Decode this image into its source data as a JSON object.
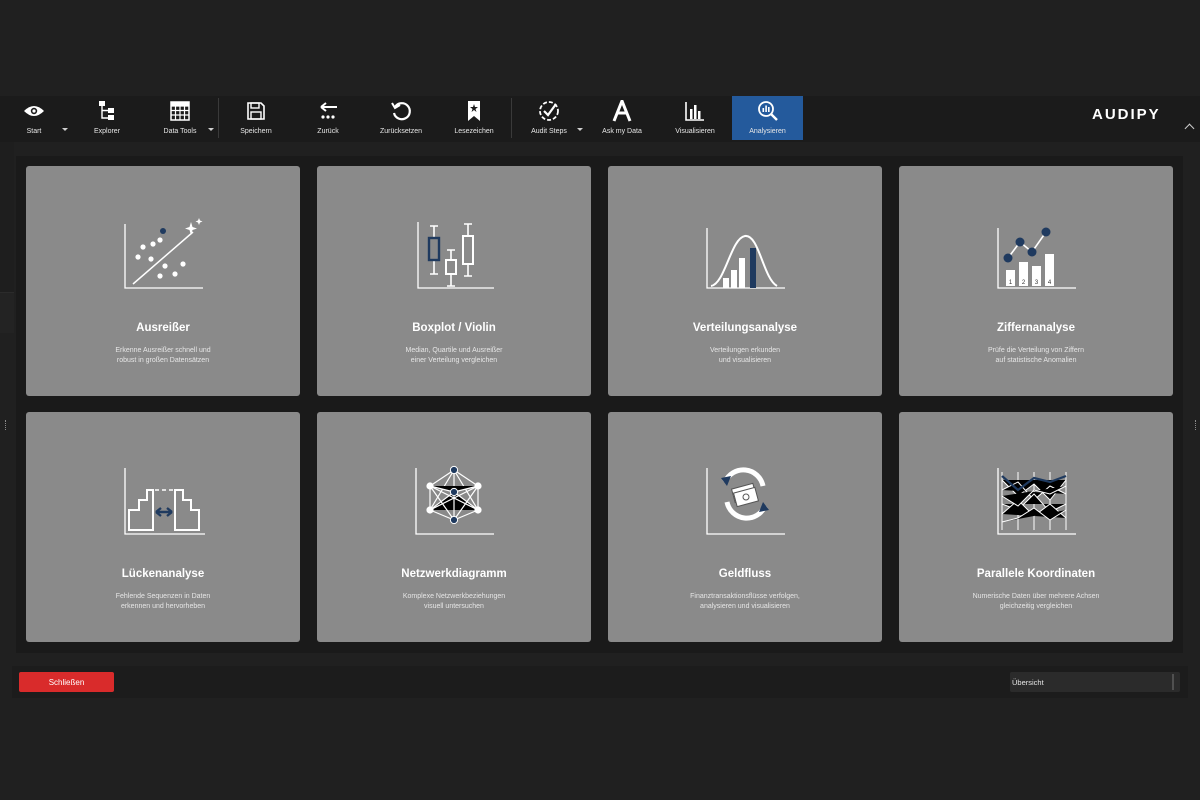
{
  "toolbar": {
    "items": [
      {
        "label": "Start",
        "icon": "eye-icon",
        "dropdown": true
      },
      {
        "label": "Explorer",
        "icon": "tree-icon"
      },
      {
        "label": "Data Tools",
        "icon": "grid-icon",
        "dropdown": true
      },
      {
        "label": "Speichern",
        "icon": "save-icon"
      },
      {
        "label": "Zurück",
        "icon": "back-icon"
      },
      {
        "label": "Zurücksetzen",
        "icon": "reset-icon"
      },
      {
        "label": "Lesezeichen",
        "icon": "bookmark-icon"
      },
      {
        "label": "Audit Steps",
        "icon": "check-circle-icon",
        "dropdown": true
      },
      {
        "label": "Ask my Data",
        "icon": "ask-data-icon"
      },
      {
        "label": "Visualisieren",
        "icon": "bar-chart-icon"
      },
      {
        "label": "Analysieren",
        "icon": "analyze-icon",
        "active": true
      }
    ],
    "active_color": "#245a9c"
  },
  "brand": {
    "logo": "AUDIPY"
  },
  "cards": [
    {
      "title": "Ausreißer",
      "desc": [
        "Erkenne Ausreißer schnell und",
        "robust in großen Datensätzen"
      ],
      "icon": "outlier-scatter-icon"
    },
    {
      "title": "Boxplot / Violin",
      "desc": [
        "Median, Quartile und Ausreißer",
        "einer Verteilung vergleichen"
      ],
      "icon": "boxplot-icon"
    },
    {
      "title": "Verteilungsanalyse",
      "desc": [
        "Verteilungen erkunden",
        "und visualisieren"
      ],
      "icon": "distribution-icon"
    },
    {
      "title": "Ziffernanalyse",
      "desc": [
        "Prüfe die Verteilung von Ziffern",
        "auf statistische Anomalien"
      ],
      "icon": "digit-analysis-icon"
    },
    {
      "title": "Lückenanalyse",
      "desc": [
        "Fehlende Sequenzen in Daten",
        "erkennen und hervorheben"
      ],
      "icon": "gap-analysis-icon"
    },
    {
      "title": "Netzwerkdiagramm",
      "desc": [
        "Komplexe Netzwerkbeziehungen",
        "visuell untersuchen"
      ],
      "icon": "network-icon"
    },
    {
      "title": "Geldfluss",
      "desc": [
        "Finanztransaktionsflüsse verfolgen,",
        "analysieren und visualisieren"
      ],
      "icon": "money-flow-icon"
    },
    {
      "title": "Parallele Koordinaten",
      "desc": [
        "Numerische Daten über mehrere Achsen",
        "gleichzeitig vergleichen"
      ],
      "icon": "parallel-coordinates-icon"
    }
  ],
  "footer": {
    "close_label": "Schließen",
    "close_color": "#d92b2b",
    "view_select": "Übersicht"
  }
}
